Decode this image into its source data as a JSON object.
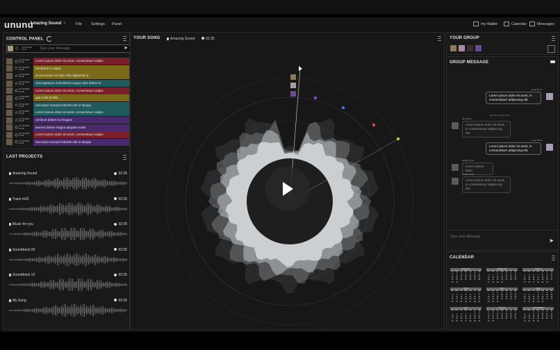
{
  "topbar": {
    "logo": "ununu",
    "app_title": "Amazing Sound",
    "close": "×",
    "menu": [
      "File",
      "Settings",
      "Panel"
    ],
    "wallet": "my Wallet",
    "calendar": "Calendar",
    "messages": "Messages"
  },
  "control_panel": {
    "title": "CONTROL PANEL",
    "input_placeholder": "Type your Message",
    "input_date": "07.03.2020",
    "input_time": "16:35",
    "rows": [
      {
        "text": "Lorem ipsum dolor sit amet, consectetuer adipis",
        "date": "07.03.2020",
        "time": "16:35",
        "color": "#7a1e2a",
        "icon": "diamond"
      },
      {
        "text": "hendrerit in vulput",
        "date": "07.03.2020",
        "time": "16:35",
        "color": "#7a6a1a",
        "icon": "star"
      },
      {
        "text": "et accumsan et iusto odio dignissim q",
        "date": "07.03.2020",
        "time": "16:35",
        "color": "#7a6a1a",
        "icon": "star"
      },
      {
        "text": "sent luptatum zzril delenit augue duis dolore te",
        "date": "07.03.2020",
        "time": "16:35",
        "color": "#1e5a5e",
        "icon": "star"
      },
      {
        "text": "Lorem ipsum dolor sit amet, consectetuer adipis",
        "date": "07.03.2020",
        "time": "16:35",
        "color": "#7a1e2a",
        "icon": "diamond"
      },
      {
        "text": "gait nulla facilisi.",
        "date": "07.03.2020",
        "time": "16:35",
        "color": "#7a6a1a",
        "icon": "diamond"
      },
      {
        "text": "amcorper suscipit lobortis nisl ut aliquip",
        "date": "07.03.2020",
        "time": "16:35",
        "color": "#1e5a5e",
        "icon": "star"
      },
      {
        "text": "Lorem ipsum dolor sit amet, consectetuer adipis",
        "date": "07.03.2020",
        "time": "16:35",
        "color": "#1e5a5e",
        "icon": "star"
      },
      {
        "text": "vel illum dolore eu feugiat",
        "date": "07.03.2020",
        "time": "16:35",
        "color": "#4a2a6e",
        "icon": "star"
      },
      {
        "text": "laoreet dolore magna aliquam erats",
        "date": "07.03.2020",
        "time": "16:35",
        "color": "#4a2a6e",
        "icon": "diamond"
      },
      {
        "text": "Lorem ipsum dolor sit amet, consectetuer adipis",
        "date": "07.03.2020",
        "time": "16:35",
        "color": "#7a1e2a",
        "icon": "diamond"
      },
      {
        "text": "amcorper suscipit lobortis nisl ut aliquip",
        "date": "07.03.2020",
        "time": "16:35",
        "color": "#4a2a6e",
        "icon": "diamond"
      }
    ]
  },
  "last_projects": {
    "title": "LAST PROJECTS",
    "items": [
      {
        "name": "Amazing Sound",
        "time": "02:35"
      },
      {
        "name": "Track m02",
        "time": "02:35"
      },
      {
        "name": "Music for you",
        "time": "02:35"
      },
      {
        "name": "Soundtrack 09",
        "time": "02:35"
      },
      {
        "name": "Soundtrack 13",
        "time": "02:35"
      },
      {
        "name": "My Song",
        "time": "02:35"
      }
    ]
  },
  "your_song": {
    "title": "YOUR SONG",
    "song_name": "Amazing Sound",
    "duration": "02:35"
  },
  "your_group": {
    "title": "YOUR GROUP"
  },
  "group_message": {
    "title": "GROUP MESSAGE",
    "input_placeholder": "Type your Message",
    "day_label": "Monday 15 Mar 2020",
    "messages": [
      {
        "side": "right",
        "time": "Anna 15:34",
        "text": "Lorem ipsum dolor sit amet, in consectetuer adipiscing elit.",
        "dim": false
      },
      {
        "side": "left",
        "time": "Jay 15:34",
        "text": "Lorem ipsum dolor sit amet, in consectetuer adipiscing elit.",
        "dim": true
      },
      {
        "side": "right",
        "time": "Anna 15:34",
        "text": "Lorem ipsum dolor sit amet, in consectetuer adipiscing elit.",
        "dim": false
      },
      {
        "side": "left",
        "time": "Grade 15:34",
        "text": "Lorem ipsum dolor",
        "dim": true
      },
      {
        "side": "left",
        "time": "Grade 15:34",
        "text": "Lorem ipsum dolor sit amet, in consectetuer adipiscing elit.",
        "dim": true
      }
    ]
  },
  "calendar": {
    "title": "CALENDAR",
    "months": [
      "JANUARY",
      "FEBRUARY",
      "MARCH",
      "APRIL",
      "MAY",
      "JUNE",
      "JULY",
      "AUGUST",
      "SEPTEMBER"
    ],
    "weekdays": [
      "Sun",
      "Mon",
      "Tue",
      "Wed",
      "Thu",
      "Fri",
      "Sat"
    ]
  },
  "colors": {
    "accent_green": "#b7e24a",
    "accent_red": "#e0473a",
    "accent_blue": "#4a6ee0",
    "accent_purple": "#8a4ad8"
  }
}
